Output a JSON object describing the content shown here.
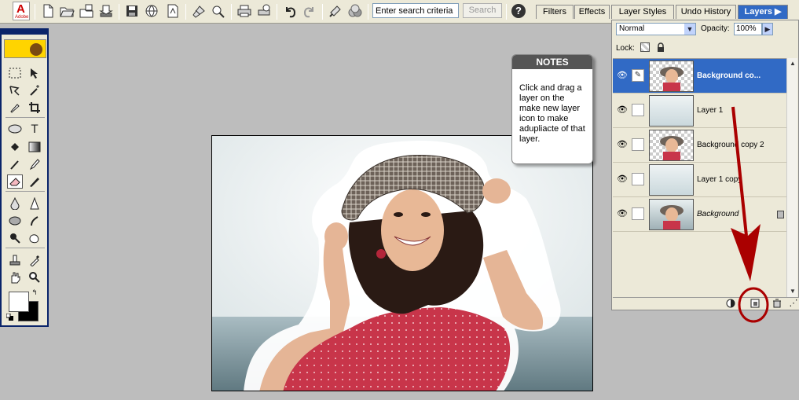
{
  "toolbar": {
    "logo_mark": "A",
    "logo_text": "Adobe",
    "icons": [
      "new-file-icon",
      "open-file-icon",
      "browse-icon",
      "import-icon",
      "save-icon",
      "save-for-web-icon",
      "save-as-pdf-icon",
      "online-services-icon",
      "attach-to-email-icon",
      "print-icon",
      "print-preview-icon",
      "step-backward-icon",
      "step-forward-icon",
      "quick-fix-icon",
      "color-variations-icon"
    ],
    "search_placeholder": "Enter search criteria",
    "search_value": "Enter search criteria",
    "search_button": "Search",
    "help_label": "?"
  },
  "palette_tabs": [
    {
      "label": "Filters"
    },
    {
      "label": "Effects"
    },
    {
      "label": "Layer Styles"
    },
    {
      "label": "Undo History"
    },
    {
      "label": "Layers ▶"
    }
  ],
  "notes": {
    "title": "NOTES",
    "text": "Click and drag a layer on the make new layer icon to make adupliacte of that layer."
  },
  "layers_palette": {
    "blend_mode": "Normal",
    "opacity_label": "Opacity:",
    "opacity_value": "100%",
    "lock_label": "Lock:",
    "layers": [
      {
        "name": "Background co...",
        "selected": true,
        "thumbnail": "transparent-with-photo",
        "visible": true
      },
      {
        "name": "Layer 1",
        "selected": false,
        "thumbnail": "sky",
        "visible": true
      },
      {
        "name": "Background copy 2",
        "selected": false,
        "thumbnail": "transparent-with-photo",
        "visible": true
      },
      {
        "name": "Layer 1 copy",
        "selected": false,
        "thumbnail": "sky",
        "visible": true
      },
      {
        "name": "Background",
        "selected": false,
        "thumbnail": "photo",
        "visible": true,
        "locked": true
      }
    ]
  },
  "colors": {
    "toolbar_bg": "#ece9d8",
    "workspace_bg": "#bdbdbd",
    "selection": "#316ac5",
    "annotation_red": "#aa0000",
    "shirt_red": "#c8354a"
  }
}
